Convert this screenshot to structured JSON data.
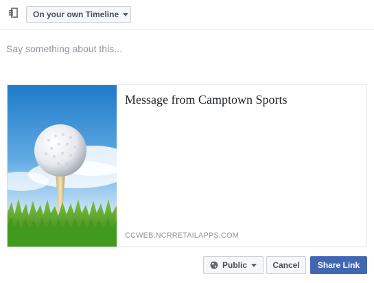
{
  "header": {
    "post_icon": "post-to-icon",
    "destination_label": "On your own Timeline"
  },
  "composer": {
    "placeholder": "Say something about this..."
  },
  "link_preview": {
    "image_icon": "golf-ball-on-tee",
    "title": "Message from Camptown Sports",
    "domain": "CCWEB.NCRRETAILAPPS.COM"
  },
  "footer": {
    "privacy_icon": "globe-icon",
    "privacy_label": "Public",
    "cancel_label": "Cancel",
    "share_label": "Share Link"
  },
  "colors": {
    "primary": "#4267b2",
    "border": "#dddfe2",
    "muted_text": "#90949c"
  }
}
